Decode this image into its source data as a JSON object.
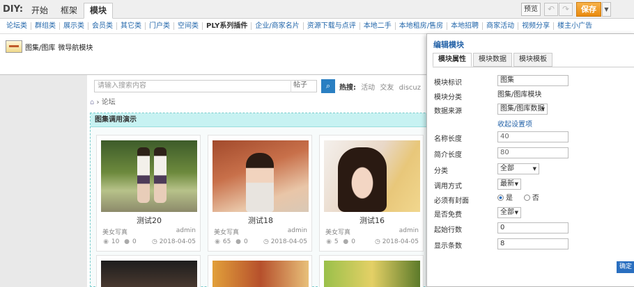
{
  "toolbar": {
    "diy_label": "DIY:",
    "tabs": [
      "开始",
      "框架",
      "模块"
    ],
    "preview_label": "预览",
    "save_label": "保存"
  },
  "categories": [
    "论坛类",
    "群组类",
    "展示类",
    "会员类",
    "其它类",
    "门户类",
    "空间类",
    "PLY系列插件",
    "企业/商家名片",
    "资源下载与点评",
    "本地二手",
    "本地租房/售房",
    "本地招聘",
    "商家活动",
    "视频分享",
    "楼主小广告"
  ],
  "modules": {
    "item1": "图集/图库",
    "item2": "微导航模块"
  },
  "page": {
    "search_placeholder": "请输入搜索内容",
    "search_type": "帖子",
    "hot_label": "热搜:",
    "hot_words": [
      "活动",
      "交友",
      "discuz"
    ],
    "breadcrumb": "论坛",
    "frame_title": "图集调用演示",
    "cards": [
      {
        "title": "测试20",
        "category": "美女写真",
        "author": "admin",
        "views": "10",
        "comments": "0",
        "date": "2018-04-05"
      },
      {
        "title": "测试18",
        "category": "美女写真",
        "author": "admin",
        "views": "65",
        "comments": "0",
        "date": "2018-04-05"
      },
      {
        "title": "测试16",
        "category": "美女写真",
        "author": "admin",
        "views": "5",
        "comments": "0",
        "date": "2018-04-05"
      }
    ]
  },
  "dialog": {
    "title": "编辑模块",
    "tabs": [
      "模块属性",
      "模块数据",
      "模块模板"
    ],
    "fields": {
      "id_label": "模块标识",
      "id_value": "图集",
      "category_label": "模块分类",
      "category_value": "图集/图库模块",
      "source_label": "数据来源",
      "source_value": "图集/图库数据",
      "advanced_link": "收起设置项",
      "name_len_label": "名称长度",
      "name_len_value": "40",
      "intro_len_label": "简介长度",
      "intro_len_value": "80",
      "class_label": "分类",
      "class_value": "全部",
      "mode_label": "调用方式",
      "mode_value": "最新",
      "cover_label": "必须有封面",
      "cover_yes": "是",
      "cover_no": "否",
      "free_label": "是否免费",
      "free_value": "全部",
      "start_label": "起始行数",
      "start_value": "0",
      "count_label": "显示条数",
      "count_value": "8"
    },
    "confirm_label": "确定"
  },
  "colors": {
    "accent": "#2563a8",
    "save": "#e98a0e",
    "frame_header": "#c7f2f2"
  }
}
